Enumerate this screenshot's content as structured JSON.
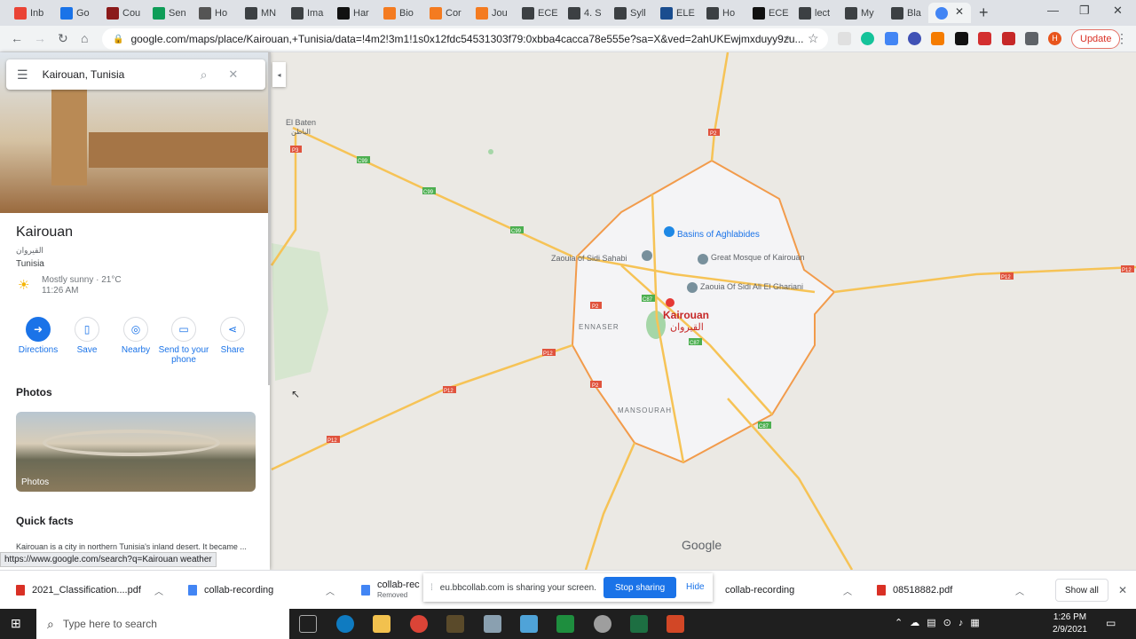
{
  "browser": {
    "tabs": [
      {
        "label": "Inb",
        "icon": "gmail-icon",
        "color": "#ea4335"
      },
      {
        "label": "Go",
        "icon": "google-classroom-icon",
        "color": "#1a73e8"
      },
      {
        "label": "Cou",
        "icon": "university-shield-icon",
        "color": "#8b1a1a"
      },
      {
        "label": "Sen",
        "icon": "teams-icon",
        "color": "#0f9d58"
      },
      {
        "label": "Ho",
        "icon": "generic-page-icon",
        "color": "#555555"
      },
      {
        "label": "MN",
        "icon": "dashboard-icon",
        "color": "#3c4043"
      },
      {
        "label": "Ima",
        "icon": "dashboard-icon",
        "color": "#3c4043"
      },
      {
        "label": "Har",
        "icon": "video-icon",
        "color": "#111111"
      },
      {
        "label": "Bio",
        "icon": "elsevier-icon",
        "color": "#f47b20"
      },
      {
        "label": "Cor",
        "icon": "elsevier-icon",
        "color": "#f47b20"
      },
      {
        "label": "Jou",
        "icon": "elsevier-icon",
        "color": "#f47b20"
      },
      {
        "label": "ECE",
        "icon": "pen-icon",
        "color": "#3c4043"
      },
      {
        "label": "4. S",
        "icon": "globe-icon",
        "color": "#3c4043"
      },
      {
        "label": "Syll",
        "icon": "globe-icon",
        "color": "#3c4043"
      },
      {
        "label": "ELE",
        "icon": "university-shield-icon",
        "color": "#1a4d8f"
      },
      {
        "label": "Ho",
        "icon": "globe-icon",
        "color": "#3c4043"
      },
      {
        "label": "ECE",
        "icon": "g-icon",
        "color": "#111111"
      },
      {
        "label": "lect",
        "icon": "dashboard-icon",
        "color": "#3c4043"
      },
      {
        "label": "My",
        "icon": "dashboard-icon",
        "color": "#3c4043"
      },
      {
        "label": "Bla",
        "icon": "dashboard-icon",
        "color": "#3c4043"
      }
    ],
    "active_tab_icon": "maps-globe-icon",
    "url": "google.com/maps/place/Kairouan,+Tunisia/data=!4m2!3m1!1s0x12fdc54531303f79:0xbba4cacca78e555e?sa=X&ved=2ahUKEwjmxduyy9zu...",
    "update_label": "Update",
    "profile_initial": "H"
  },
  "panel": {
    "search_value": "Kairouan, Tunisia",
    "title": "Kairouan",
    "arabic_name": "القيروان",
    "country": "Tunisia",
    "weather_line1": "Mostly sunny · 21°C",
    "weather_line2": "11:26 AM",
    "actions": [
      {
        "label": "Directions",
        "icon": "directions-icon"
      },
      {
        "label": "Save",
        "icon": "bookmark-icon"
      },
      {
        "label": "Nearby",
        "icon": "nearby-icon"
      },
      {
        "label": "Send to your phone",
        "icon": "send-to-phone-icon"
      },
      {
        "label": "Share",
        "icon": "share-icon"
      }
    ],
    "photos_heading": "Photos",
    "photo_caption": "Photos",
    "quick_facts_heading": "Quick facts",
    "quick_facts_text": "Kairouan is a city in northern Tunisia's inland desert. It became ... ship in the",
    "status_url": "https://www.google.com/search?q=Kairouan weather"
  },
  "map": {
    "labels": {
      "el_baten": "El Baten",
      "el_baten_ar": "الباطن",
      "basins": "Basins of Aghlabides",
      "great_mosque": "Great Mosque of Kairouan",
      "zaouia_sahabi": "Zaouia of Sidi Sahabi",
      "zaouia_ghariani": "Zaouia Of Sidi Ali El Ghariani",
      "city": "Kairouan",
      "city_ar": "القيروان",
      "ennaser": "ENNASER",
      "mansourah": "MANSOURAH",
      "google_logo": "Google"
    },
    "road_shields": [
      "P3",
      "C99",
      "C99",
      "C99",
      "P2",
      "P2",
      "P12",
      "P12",
      "P12",
      "C87",
      "C87",
      "C87",
      "P12",
      "P2",
      "P12"
    ]
  },
  "downloads": {
    "items": [
      {
        "name": "2021_Classification....pdf",
        "type": "pdf"
      },
      {
        "name": "collab-recording",
        "type": "doc"
      },
      {
        "name": "collab-rec",
        "sub": "Removed",
        "type": "doc"
      },
      {
        "name": "collab-recording",
        "type": "doc"
      },
      {
        "name": "08518882.pdf",
        "type": "pdf"
      }
    ],
    "show_all": "Show all",
    "share_message": "eu.bbcollab.com is sharing your screen.",
    "stop_sharing": "Stop sharing",
    "hide": "Hide"
  },
  "taskbar": {
    "search_placeholder": "Type here to search",
    "time": "1:26 PM",
    "date": "2/9/2021",
    "apps": [
      "task-view-icon",
      "edge-icon",
      "file-explorer-icon",
      "chrome-icon",
      "media-player-icon",
      "app-icon",
      "notepad-icon",
      "green-s-icon",
      "music-icon",
      "excel-icon",
      "powerpoint-icon"
    ]
  }
}
